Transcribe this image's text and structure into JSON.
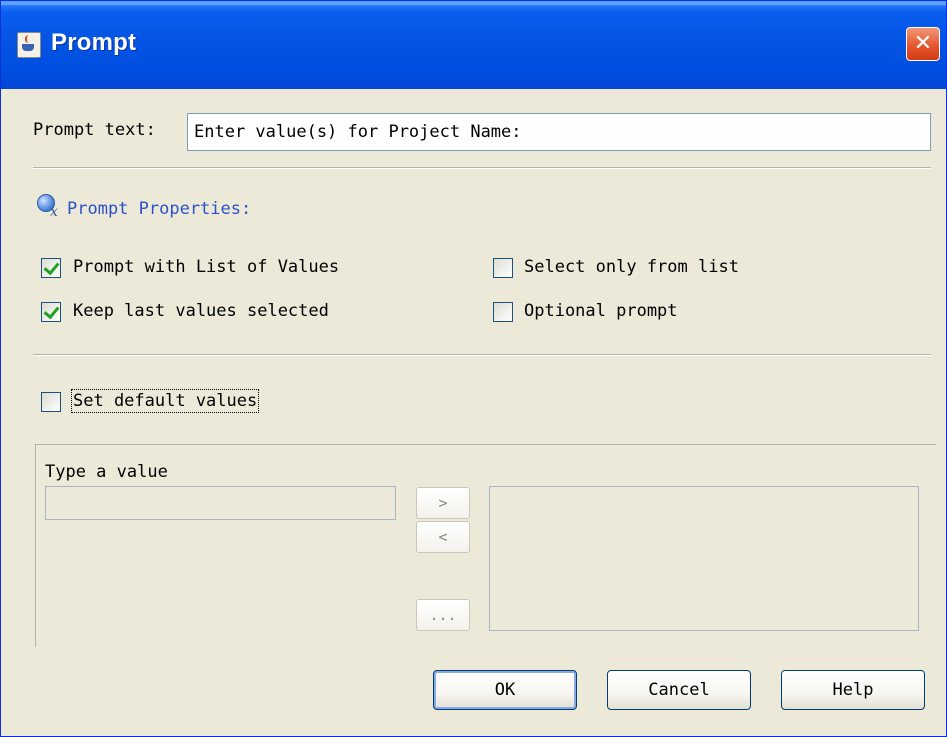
{
  "window": {
    "title": "Prompt",
    "close_glyph": "✕",
    "icon": "java-cup-icon"
  },
  "prompt_text": {
    "label": "Prompt text:",
    "value": "Enter value(s) for Project Name:"
  },
  "properties": {
    "title": "Prompt Properties:",
    "icon": "prompt-properties-icon",
    "options": [
      {
        "label": "Prompt with List of Values",
        "checked": true
      },
      {
        "label": "Keep last values selected",
        "checked": true
      },
      {
        "label": "Select only from list",
        "checked": false
      },
      {
        "label": "Optional prompt",
        "checked": false
      }
    ]
  },
  "defaults": {
    "label": "Set default values",
    "checked": false,
    "type_value_label": "Type a value",
    "type_value": "",
    "add_button": ">",
    "remove_button": "<",
    "browse_button": "..."
  },
  "footer": {
    "ok": "OK",
    "cancel": "Cancel",
    "help": "Help"
  },
  "colors": {
    "title_bar": "#0554e3",
    "dialog_bg": "#ece9d8",
    "section_title": "#2a52c8",
    "check_mark": "#21a121",
    "close_button": "#e5572f"
  }
}
